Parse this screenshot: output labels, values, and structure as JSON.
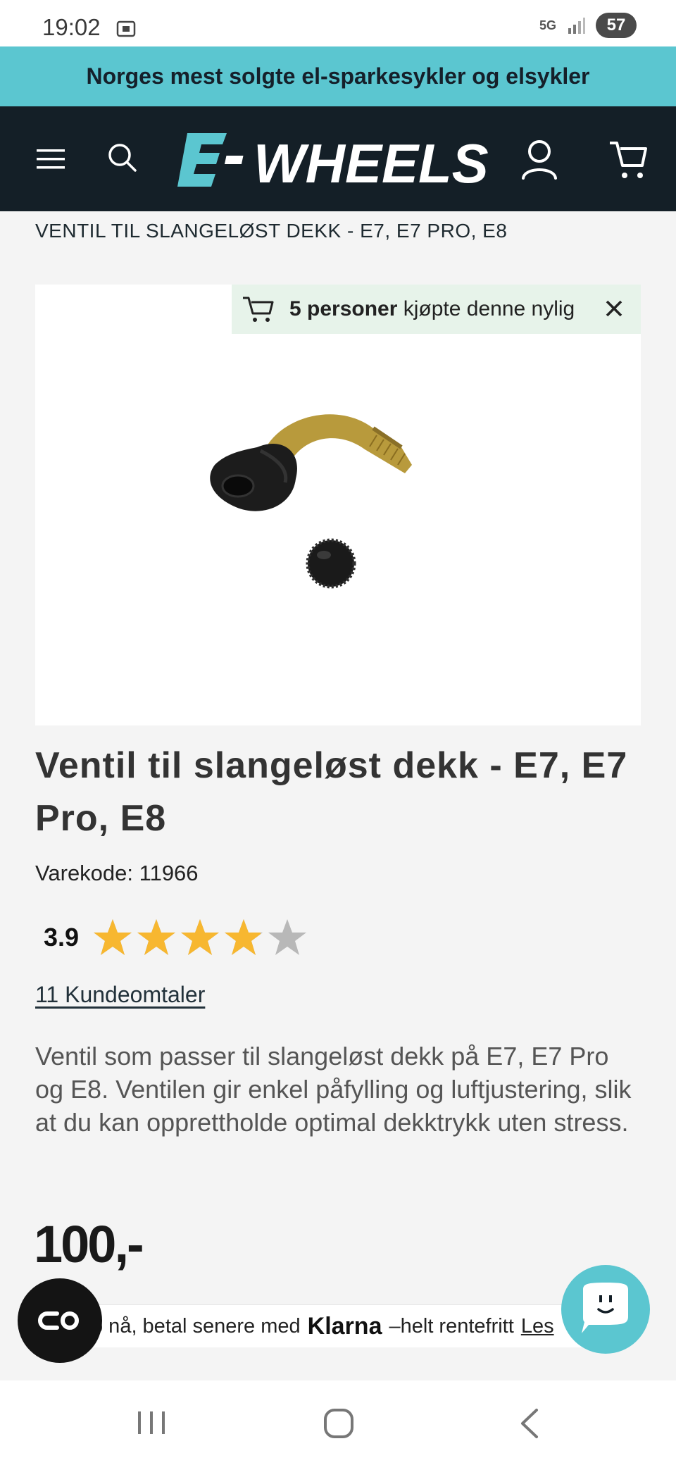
{
  "status_bar": {
    "time": "19:02",
    "network": "5G",
    "battery": "57",
    "icons": [
      "screen-record-icon",
      "signal-icon",
      "battery-icon"
    ]
  },
  "promo_banner": {
    "text": "Norges mest solgte el-sparkesykler og elsykler"
  },
  "header": {
    "logo_text": "E-WHEELS",
    "icons": [
      "menu-icon",
      "search-icon",
      "user-icon",
      "cart-icon"
    ],
    "colors": {
      "background": "#141f27",
      "accent": "#5bc6d0"
    }
  },
  "breadcrumb": {
    "current": "VENTIL TIL SLANGELØST DEKK - E7, E7 PRO, E8"
  },
  "social_proof": {
    "count_bold": "5 personer",
    "rest": " kjøpte denne nylig",
    "icons": [
      "cart-icon",
      "close-icon"
    ]
  },
  "product": {
    "title": "Ventil til slangeløst dekk - E7, E7 Pro, E8",
    "sku_label": "Varekode:",
    "sku_value": "11966",
    "rating": "3.9",
    "rating_max": 5,
    "reviews_link": "11 Kundeomtaler",
    "description": "Ventil som passer til slangeløst dekk på E7, E7 Pro og E8. Ventilen gir enkel påfylling og luftjustering, slik at du kan opprettholde optimal dekktrykk uten stress.",
    "price": "100,-",
    "star_color": "#f7b730"
  },
  "klarna": {
    "prefix": "o nå, betal senere med",
    "brand": "Klarna",
    "suffix": "–helt rentefritt",
    "link": "Les"
  },
  "floating": {
    "left_icon": "accessibility-icon",
    "right_icon": "chat-icon"
  },
  "nav_bar": {
    "icons": [
      "recent-apps-icon",
      "home-icon",
      "back-icon"
    ]
  }
}
